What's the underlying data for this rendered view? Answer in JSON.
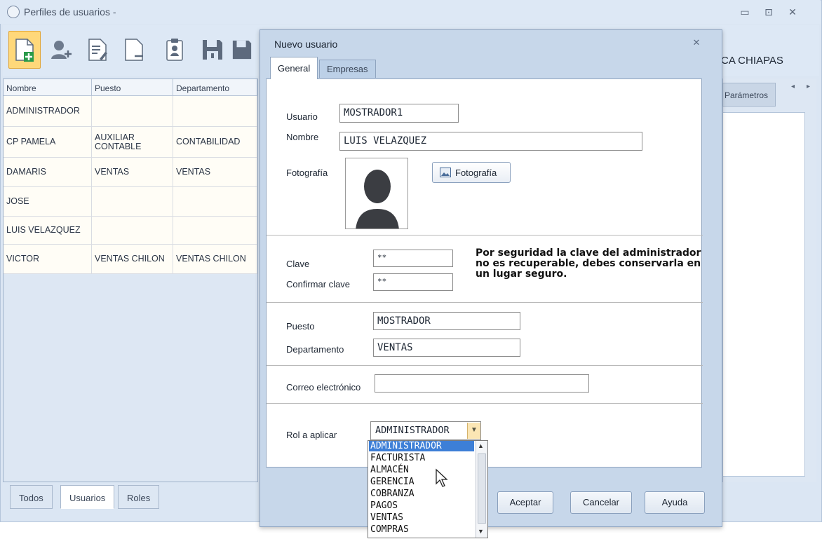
{
  "main_window": {
    "title": "Perfiles de usuarios -",
    "company": "CA CHIAPAS",
    "right_tab": "Parámetros"
  },
  "users_table": {
    "columns": [
      "Nombre",
      "Puesto",
      "Departamento"
    ],
    "rows": [
      {
        "nombre": "ADMINISTRADOR",
        "puesto": "",
        "departamento": ""
      },
      {
        "nombre": "CP PAMELA",
        "puesto": "AUXILIAR CONTABLE",
        "departamento": "CONTABILIDAD"
      },
      {
        "nombre": "DAMARIS",
        "puesto": "VENTAS",
        "departamento": "VENTAS"
      },
      {
        "nombre": "JOSE",
        "puesto": "",
        "departamento": ""
      },
      {
        "nombre": "LUIS VELAZQUEZ",
        "puesto": "",
        "departamento": ""
      },
      {
        "nombre": "VICTOR",
        "puesto": "VENTAS CHILON",
        "departamento": "VENTAS CHILON"
      }
    ]
  },
  "bottom_tabs": [
    "Todos",
    "Usuarios",
    "Roles"
  ],
  "dialog": {
    "title": "Nuevo usuario",
    "tabs": [
      "General",
      "Empresas"
    ],
    "usuario_label": "Usuario",
    "usuario_value": "MOSTRADOR1",
    "nombre_label": "Nombre",
    "nombre_value": "LUIS VELAZQUEZ",
    "fotografia_label": "Fotografía",
    "fotografia_button": "Fotografía",
    "clave_label": "Clave",
    "clave_value": "**",
    "confirmar_label": "Confirmar clave",
    "confirmar_value": "**",
    "warning": "Por seguridad la clave del administrador no es recuperable, debes conservarla en un lugar seguro.",
    "puesto_label": "Puesto",
    "puesto_value": "MOSTRADOR",
    "departamento_label": "Departamento",
    "departamento_value": "VENTAS",
    "correo_label": "Correo electrónico",
    "correo_value": "",
    "rol_label": "Rol a aplicar",
    "rol_value": "ADMINISTRADOR",
    "rol_options": [
      "ADMINISTRADOR",
      "FACTURISTA",
      "ALMACÉN",
      "GERENCIA",
      "COBRANZA",
      "PAGOS",
      "VENTAS",
      "COMPRAS"
    ],
    "buttons": {
      "aceptar": "Aceptar",
      "cancelar": "Cancelar",
      "ayuda": "Ayuda"
    }
  },
  "colors": {
    "accent": "#3d7fd7",
    "new_button": "#ffd87a",
    "dialog_bg": "#c7d7ea"
  }
}
